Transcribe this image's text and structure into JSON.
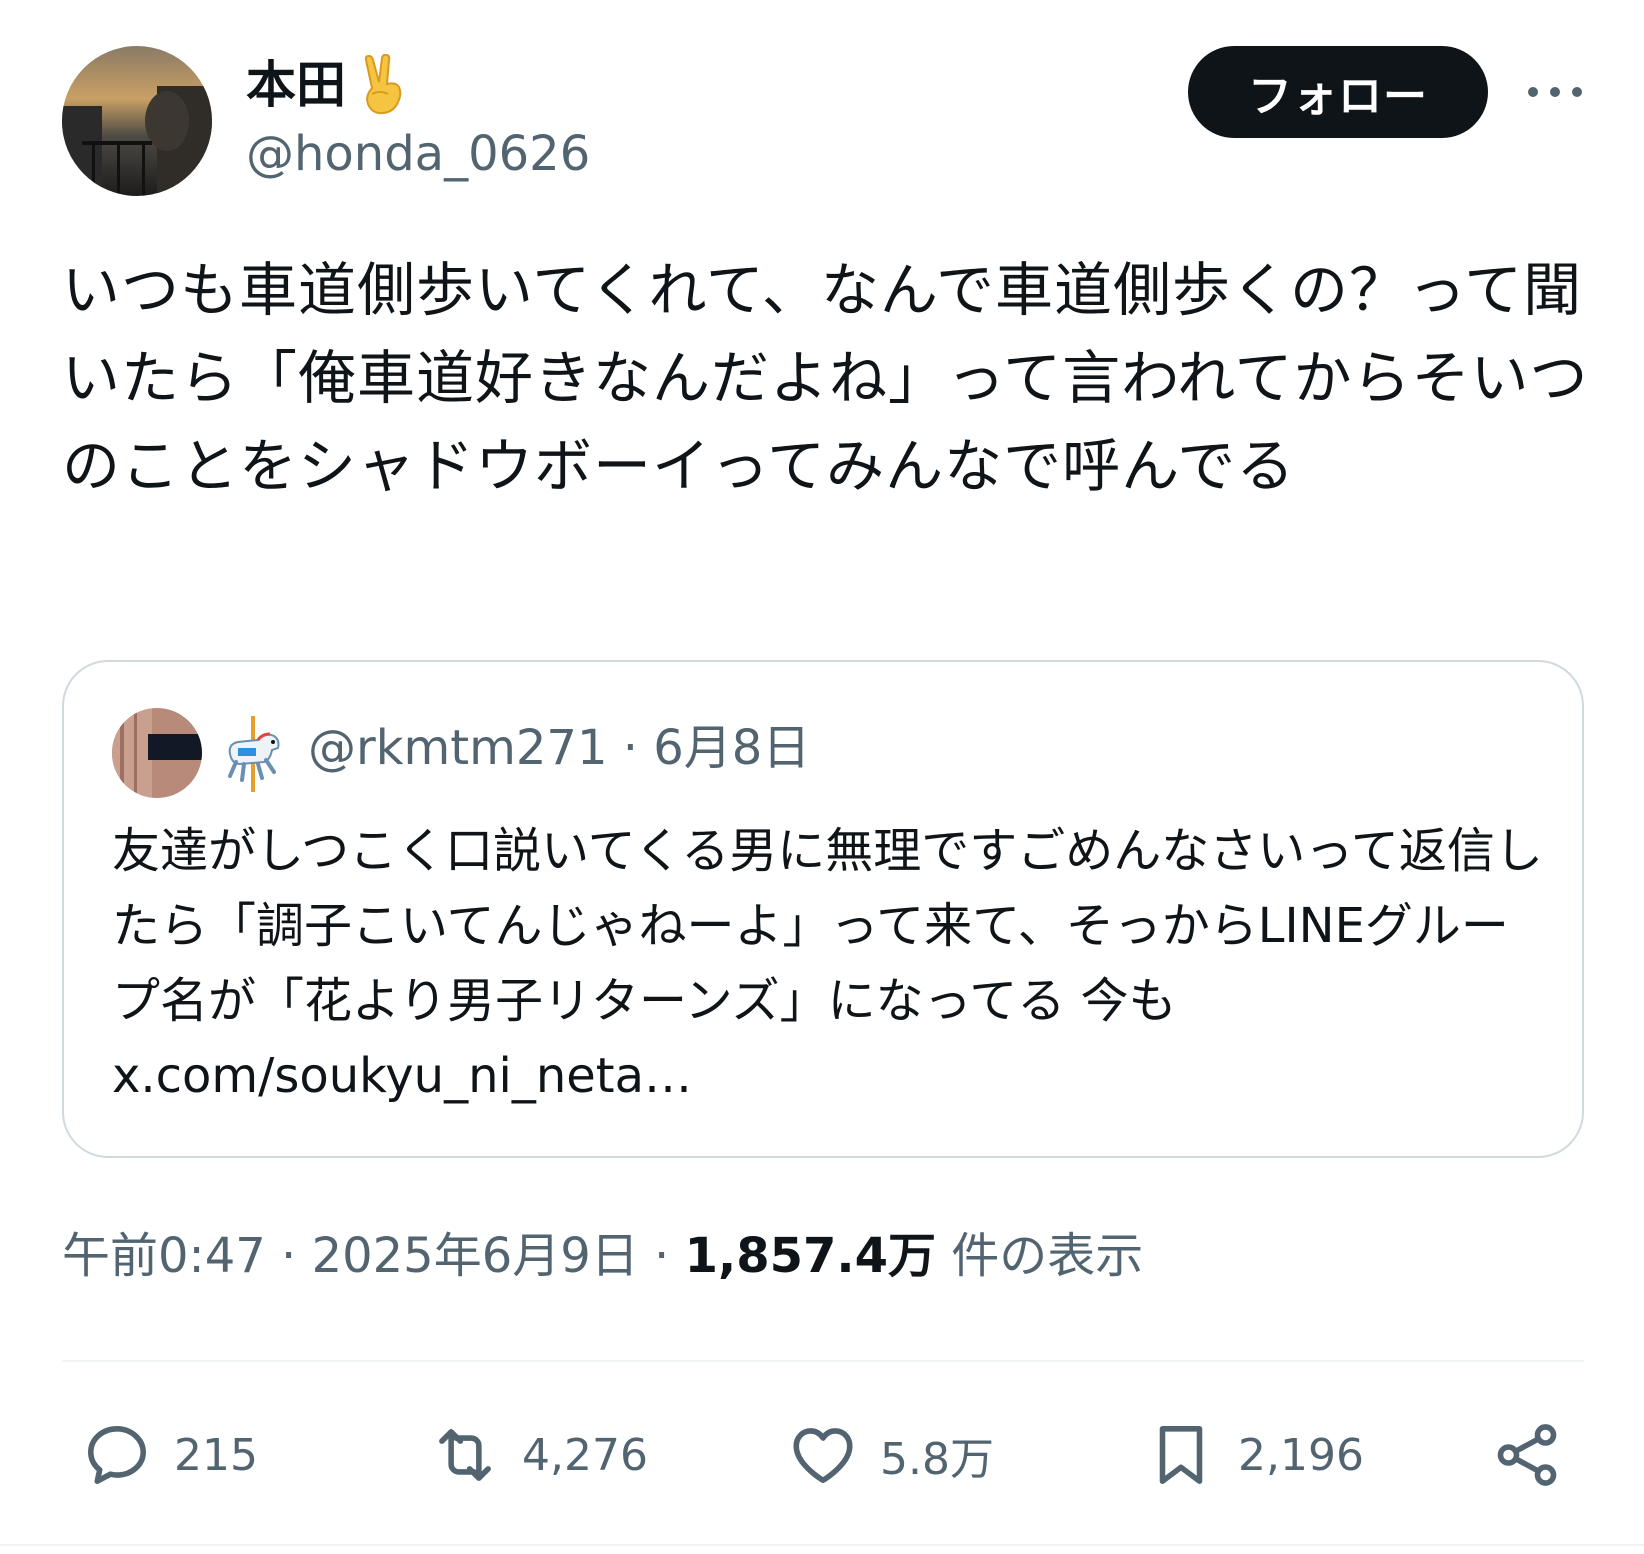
{
  "author": {
    "display_name": "本田",
    "handle": "@honda_0626",
    "name_emoji": "peace-hand-emoji"
  },
  "header": {
    "follow_label": "フォロー",
    "more_icon": "more-horizontal-icon"
  },
  "tweet": {
    "text": "いつも車道側歩いてくれて、なんで車道側歩くの？って聞いたら「俺車道好きなんだよね」って言われてからそいつのことをシャドウボーイってみんなで呼んでる"
  },
  "quote": {
    "emoji": "carousel-horse-emoji",
    "meta": "@rkmtm271 · 6月8日",
    "text": "友達がしつこく口説いてくる男に無理ですごめんなさいって返信したら「調子こいてんじゃねーよ」って来て、そっからLINEグループ名が「花より男子リターンズ」になってる 今も x.com/soukyu_ni_neta…"
  },
  "meta": {
    "timestamp": "午前0:47 · 2025年6月9日 · ",
    "views_count": "1,857.4万",
    "views_label": " 件の表示"
  },
  "actions": {
    "reply_count": "215",
    "repost_count": "4,276",
    "like_count": "5.8万",
    "bookmark_count": "2,196"
  },
  "colors": {
    "text_primary": "#0f1419",
    "text_secondary": "#536471",
    "border": "#cfd9de",
    "follow_bg": "#0f1419"
  }
}
